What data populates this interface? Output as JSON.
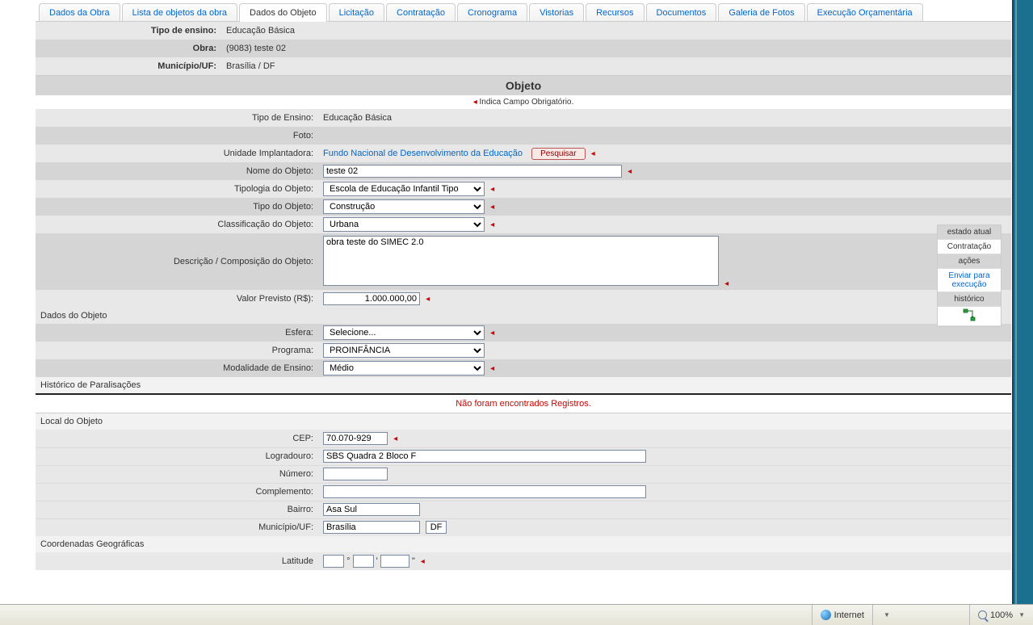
{
  "tabs": [
    {
      "label": "Dados da Obra"
    },
    {
      "label": "Lista de objetos da obra"
    },
    {
      "label": "Dados do Objeto",
      "active": true
    },
    {
      "label": "Licitação"
    },
    {
      "label": "Contratação"
    },
    {
      "label": "Cronograma"
    },
    {
      "label": "Vistorias"
    },
    {
      "label": "Recursos"
    },
    {
      "label": "Documentos"
    },
    {
      "label": "Galeria de Fotos"
    },
    {
      "label": "Execução Orçamentária"
    }
  ],
  "header": {
    "tipo_ensino_label": "Tipo de ensino:",
    "tipo_ensino": "Educação Básica",
    "obra_label": "Obra:",
    "obra": "(9083) teste 02",
    "municipio_label": "Município/UF:",
    "municipio": "Brasília / DF"
  },
  "section_title": "Objeto",
  "mandatory_note": "Indica Campo Obrigatório.",
  "form": {
    "tipo_ensino_label": "Tipo de Ensino:",
    "tipo_ensino": "Educação Básica",
    "foto_label": "Foto:",
    "unidade_label": "Unidade Implantadora:",
    "unidade_link": "Fundo Nacional de Desenvolvimento da Educação",
    "pesquisar_btn": "Pesquisar",
    "nome_label": "Nome do Objeto:",
    "nome_value": "teste 02",
    "tipologia_label": "Tipologia do Objeto:",
    "tipologia_value": "Escola de Educação Infantil Tipo",
    "tipo_obj_label": "Tipo do Objeto:",
    "tipo_obj_value": "Construção",
    "class_label": "Classificação do Objeto:",
    "class_value": "Urbana",
    "desc_label": "Descrição / Composição do Objeto:",
    "desc_value": "obra teste do SIMEC 2.0",
    "valor_label": "Valor Previsto (R$):",
    "valor_value": "1.000.000,00"
  },
  "dados_objeto": {
    "header": "Dados do Objeto",
    "esfera_label": "Esfera:",
    "esfera_value": "Selecione...",
    "programa_label": "Programa:",
    "programa_value": "PROINFÂNCIA",
    "modalidade_label": "Modalidade de Ensino:",
    "modalidade_value": "Médio"
  },
  "historico": {
    "header": "Histórico de Paralisações",
    "no_records": "Não foram encontrados Registros."
  },
  "local": {
    "header": "Local do Objeto",
    "cep_label": "CEP:",
    "cep_value": "70.070-929",
    "logradouro_label": "Logradouro:",
    "logradouro_value": "SBS Quadra 2 Bloco F",
    "numero_label": "Número:",
    "numero_value": "",
    "complemento_label": "Complemento:",
    "complemento_value": "",
    "bairro_label": "Bairro:",
    "bairro_value": "Asa Sul",
    "municipio_label": "Município/UF:",
    "municipio_value": "Brasília",
    "uf_value": "DF"
  },
  "coords": {
    "header": "Coordenadas Geográficas",
    "lat_label": "Latitude",
    "deg": "",
    "min": "",
    "sec": ""
  },
  "side_panel": {
    "estado_head": "estado atual",
    "estado_value": "Contratação",
    "acoes_head": "ações",
    "enviar": "Enviar para execução",
    "historico": "histórico"
  },
  "statusbar": {
    "internet": "Internet",
    "zoom": "100%"
  }
}
